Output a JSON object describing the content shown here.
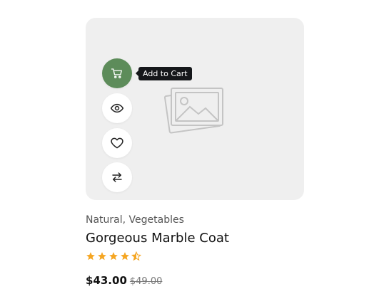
{
  "product": {
    "category": "Natural, Vegetables",
    "title": "Gorgeous Marble Coat",
    "rating": 4.5,
    "rating_max": 5,
    "price_current": "$43.00",
    "price_old": "$49.00"
  },
  "actions": {
    "cart_tooltip": "Add to Cart",
    "cart_icon": "cart-icon",
    "view_icon": "eye-icon",
    "wishlist_icon": "heart-icon",
    "compare_icon": "arrows-swap-icon"
  },
  "colors": {
    "accent": "#5d8c5a",
    "star": "#f5a623",
    "card_bg": "#efefef",
    "tooltip_bg": "#15171a"
  }
}
